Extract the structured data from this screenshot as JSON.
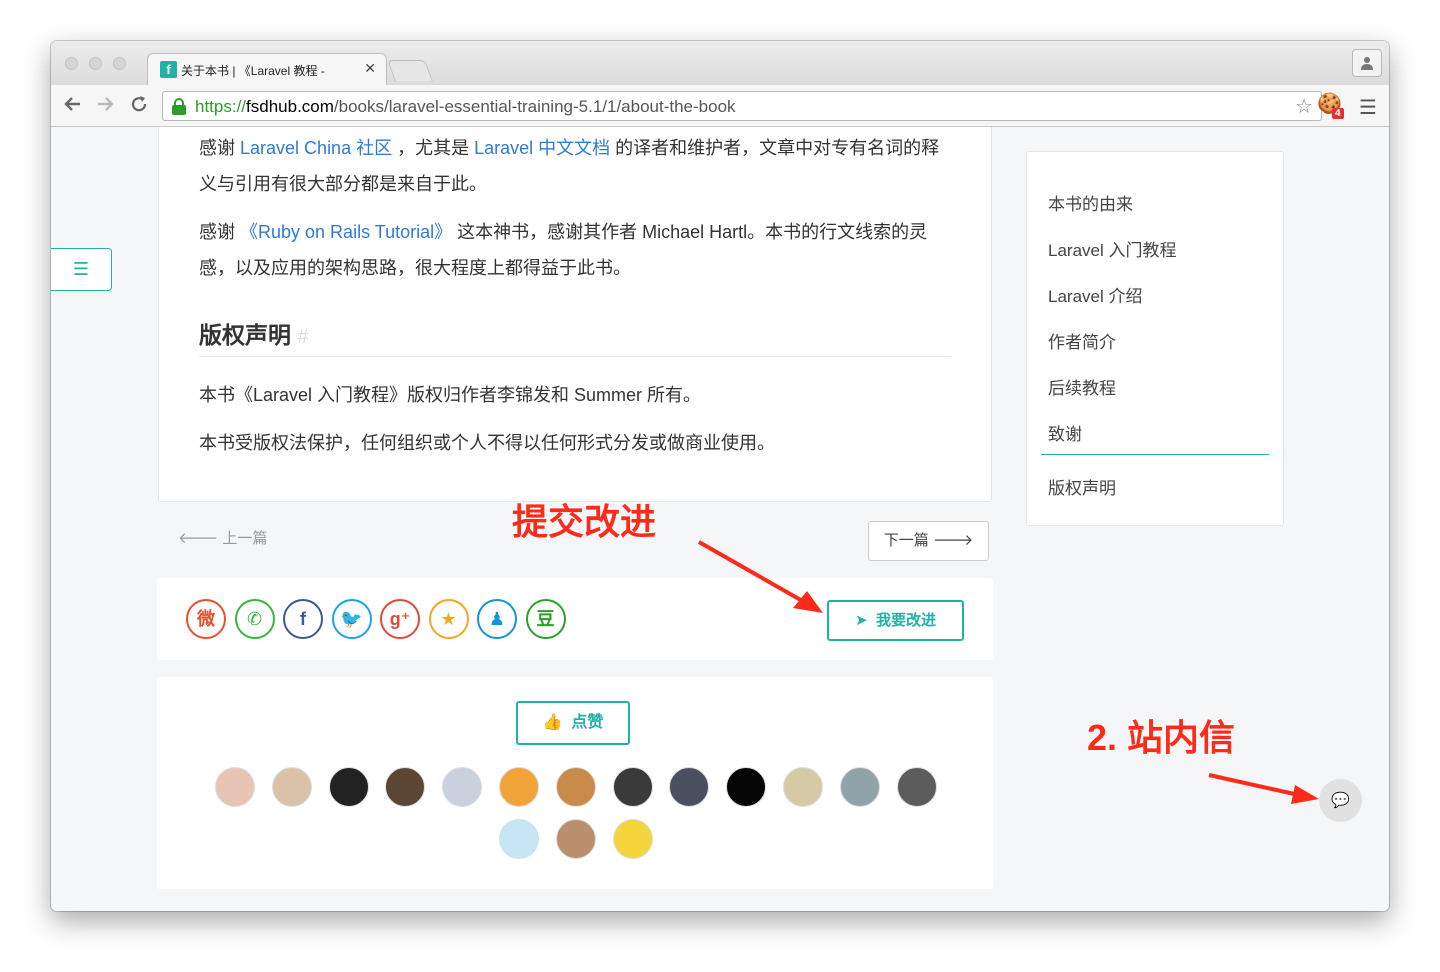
{
  "browser": {
    "tab_title": "关于本书 | 《Laravel 教程 - ",
    "tab_close": "✕",
    "url_scheme": "https://",
    "url_host": "fsdhub.com",
    "url_path": "/books/laravel-essential-training-5.1/1/about-the-book",
    "extension_badge": "4",
    "icons": [
      "back-arrow-icon",
      "forward-arrow-icon",
      "reload-icon",
      "lock-icon",
      "star-icon",
      "menu-icon",
      "profile-icon"
    ]
  },
  "article": {
    "thanks1_pre": "感谢 ",
    "thanks1_link1": "Laravel China 社区",
    "thanks1_mid": " ，尤其是 ",
    "thanks1_link2": "Laravel 中文文档",
    "thanks1_post": " 的译者和维护者，文章中对专有名词的释义与引用有很大部分都是来自于此。",
    "thanks2_pre": "感谢 ",
    "thanks2_link": "《Ruby on Rails Tutorial》",
    "thanks2_post": " 这本神书，感谢其作者 Michael Hartl。本书的行文线索的灵感，以及应用的架构思路，很大程度上都得益于此书。",
    "copyright_title": "版权声明",
    "copyright_hash": "#",
    "copyright_p1": "本书《Laravel 入门教程》版权归作者李锦发和 Summer 所有。",
    "copyright_p2": "本书受版权法保护，任何组织或个人不得以任何形式分发或做商业使用。"
  },
  "pager": {
    "prev_arrow": "🡐",
    "prev_label": "上一篇",
    "next_label": "下一篇",
    "next_arrow": "🡒"
  },
  "share": {
    "icons": [
      {
        "name": "weibo-icon",
        "glyph": "微",
        "color": "#e6522c"
      },
      {
        "name": "wechat-icon",
        "glyph": "✆",
        "color": "#3bb53b"
      },
      {
        "name": "facebook-icon",
        "glyph": "f",
        "color": "#3b5998"
      },
      {
        "name": "twitter-icon",
        "glyph": "🐦",
        "color": "#1da1f2"
      },
      {
        "name": "googleplus-icon",
        "glyph": "g⁺",
        "color": "#dd4b39"
      },
      {
        "name": "qzone-icon",
        "glyph": "★",
        "color": "#f5a623"
      },
      {
        "name": "qq-icon",
        "glyph": "♟",
        "color": "#1296db"
      },
      {
        "name": "douban-icon",
        "glyph": "豆",
        "color": "#2ca02c"
      }
    ],
    "improve_icon": "➤",
    "improve_label": "我要改进"
  },
  "like": {
    "icon": "👍",
    "label": "点赞",
    "avatars": [
      "#e8c4b4",
      "#d9c2a8",
      "#222222",
      "#5a4632",
      "#c9d1dc",
      "#f2a33a",
      "#c98a4a",
      "#3a3a3a",
      "#4a5060",
      "#050505",
      "#d6c9a6",
      "#8fa3a8",
      "#5c5c5c",
      "#c7e6f5",
      "#b98f6e",
      "#f4d53c"
    ]
  },
  "toc": {
    "items": [
      "本书的由来",
      "Laravel 入门教程",
      "Laravel 介绍",
      "作者简介",
      "后续教程",
      "致谢",
      "版权声明"
    ]
  },
  "annotations": {
    "submit": "提交改进",
    "pm": "2. 站内信"
  },
  "chat": {
    "icon": "💬"
  }
}
